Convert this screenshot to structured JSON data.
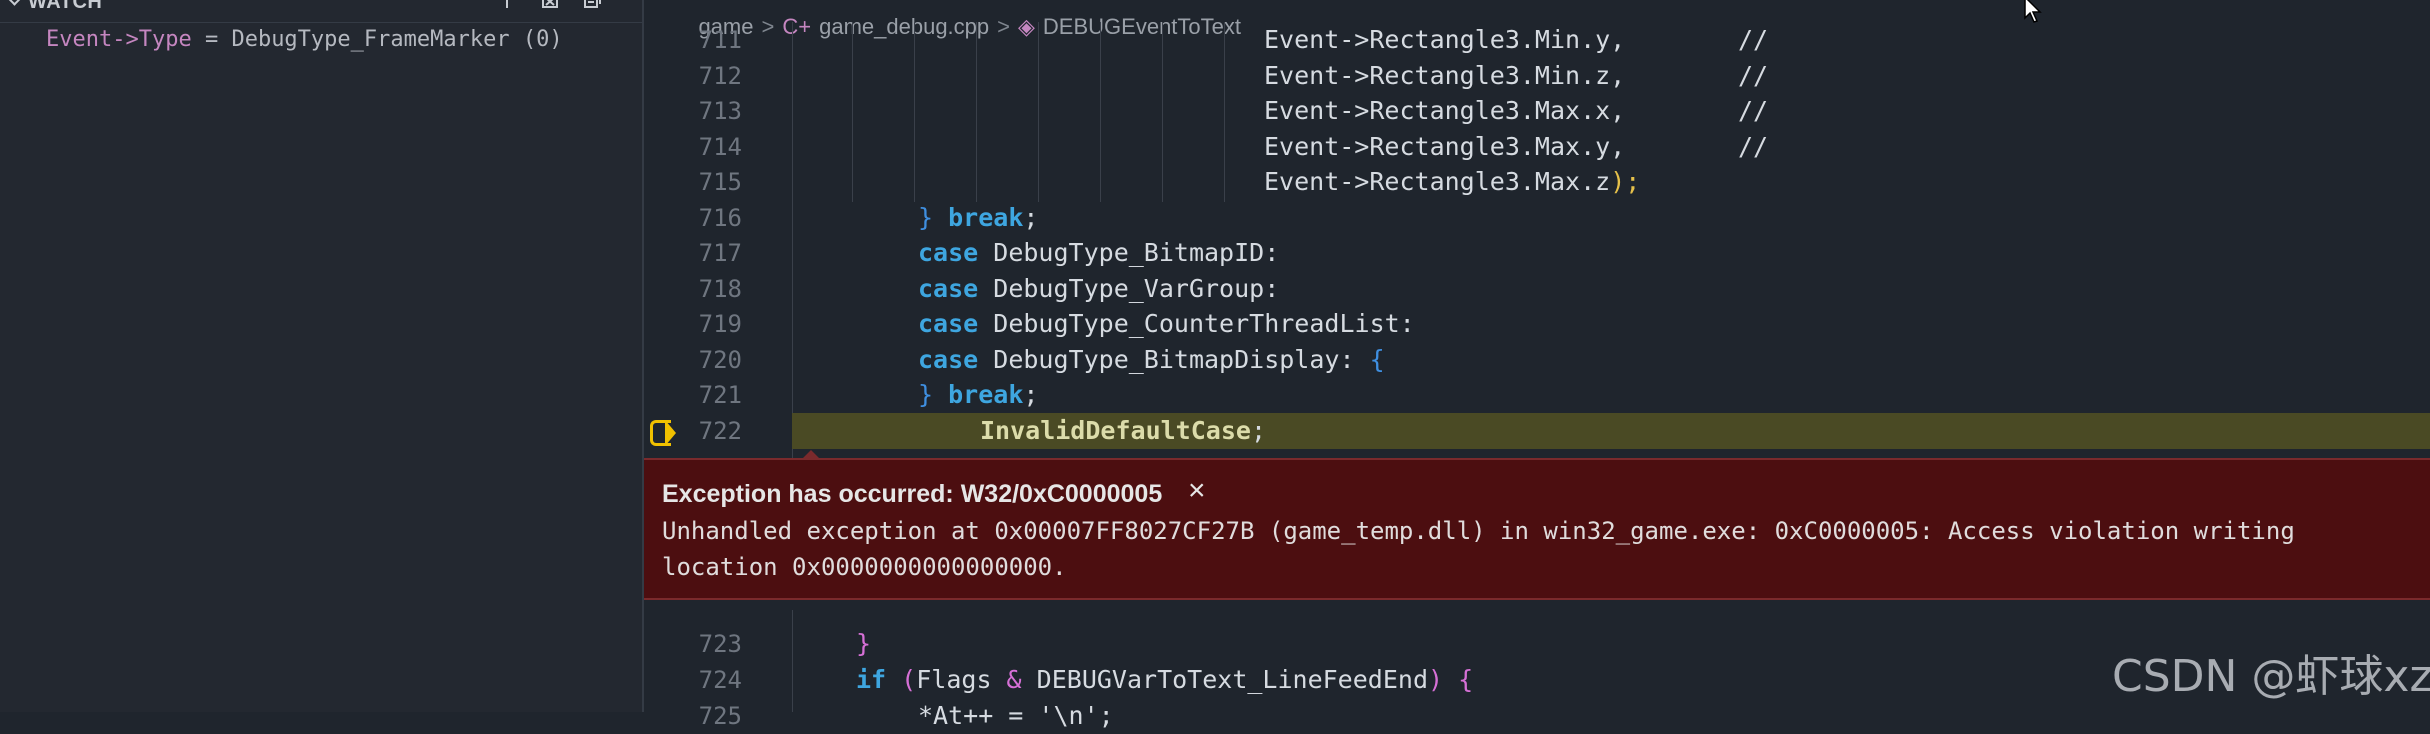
{
  "watch_panel": {
    "title": "WATCH",
    "expr_name": "Event->Type",
    "expr_eq": " = ",
    "expr_value": "DebugType_FrameMarker (0)",
    "icons": [
      "add-expression-icon",
      "remove-all-expressions-icon",
      "collapse-all-icon"
    ]
  },
  "breadcrumb": {
    "items": [
      "game",
      "game_debug.cpp",
      "DEBUGEventToText"
    ],
    "separator": ">",
    "file_icon": "cpp-file-icon",
    "symbol_icon": "function-symbol-icon"
  },
  "code": {
    "lines": {
      "711": {
        "num": "711",
        "text": "Event->Rectangle3.Min.y,",
        "cmt": "//"
      },
      "712": {
        "num": "712",
        "text": "Event->Rectangle3.Min.z,",
        "cmt": "//"
      },
      "713": {
        "num": "713",
        "text": "Event->Rectangle3.Max.x,",
        "cmt": "//"
      },
      "714": {
        "num": "714",
        "text": "Event->Rectangle3.Max.y,",
        "cmt": "//"
      },
      "715": {
        "num": "715",
        "text": "Event->Rectangle3.Max.z",
        "close": ");"
      },
      "716": {
        "num": "716",
        "brace": "}",
        "kw": "break",
        "rest": ";"
      },
      "717": {
        "num": "717",
        "kw": "case",
        "rest": "DebugType_BitmapID:"
      },
      "718": {
        "num": "718",
        "kw": "case",
        "rest": "DebugType_VarGroup:"
      },
      "719": {
        "num": "719",
        "kw": "case",
        "rest": "DebugType_CounterThreadList:"
      },
      "720": {
        "num": "720",
        "kw": "case",
        "rest": "DebugType_BitmapDisplay: ",
        "brace": "{"
      },
      "721": {
        "num": "721",
        "brace": "}",
        "kw": "break",
        "rest": ";"
      },
      "722": {
        "num": "722",
        "fn": "InvalidDefaultCase",
        "rest": ";"
      },
      "723": {
        "num": "723",
        "brace": "}"
      },
      "724": {
        "num": "724",
        "kw": "if",
        "open": "(",
        "a": "Flags ",
        "amp": "&",
        "b": " DEBUGVarToText_LineFeedEnd",
        "close": ")",
        "brace": " {"
      },
      "725": {
        "num": "725",
        "text": "*At++ = '\\n';"
      }
    }
  },
  "exception": {
    "title": "Exception has occurred: W32/0xC0000005",
    "close_glyph": "×",
    "message_line1": "Unhandled exception at 0x00007FF8027CF27B (game_temp.dll) in win32_game.exe: 0xC0000005: Access violation writing",
    "message_line2": "location 0x0000000000000000."
  },
  "watermark": "CSDN @虾球xz",
  "colors": {
    "exception_bg": "#4c0e10",
    "current_line_bg": "#4a4a24",
    "keyword": "#4fc1ff",
    "exec_arrow": "#f0c000"
  }
}
